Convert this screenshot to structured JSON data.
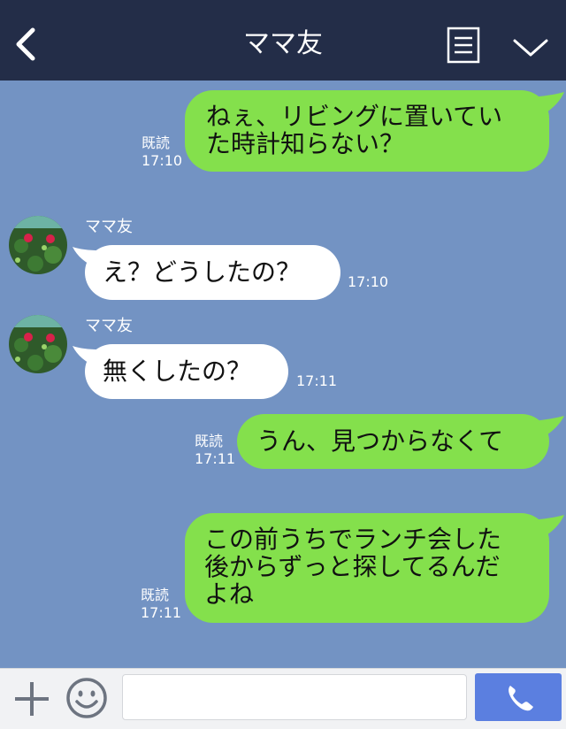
{
  "header": {
    "title": "ママ友"
  },
  "messages": [
    {
      "text": "ねぇ、リビングに置いてい\nた時計知らない？",
      "read": "既読",
      "time": "17:10"
    },
    {
      "sender": "ママ友",
      "text": "え？どうしたの？",
      "time": "17:10"
    },
    {
      "sender": "ママ友",
      "text": "無くしたの？",
      "time": "17:11"
    },
    {
      "text": "うん、見つからなくて",
      "read": "既読",
      "time": "17:11"
    },
    {
      "text": "この前うちでランチ会した\n後からずっと探してるんだ\nよね",
      "read": "既読",
      "time": "17:11"
    }
  ],
  "composer": {
    "placeholder": ""
  },
  "colors": {
    "background": "#7393c3",
    "header": "#232d48",
    "my_bubble": "#84e04c",
    "their_bubble": "#ffffff",
    "call_button": "#5b7fe0"
  },
  "icons": {
    "back": "chevron-left-icon",
    "menu": "menu-list-icon",
    "collapse": "chevron-down-icon",
    "add": "plus-icon",
    "emoji": "smiley-icon",
    "call": "phone-icon"
  }
}
